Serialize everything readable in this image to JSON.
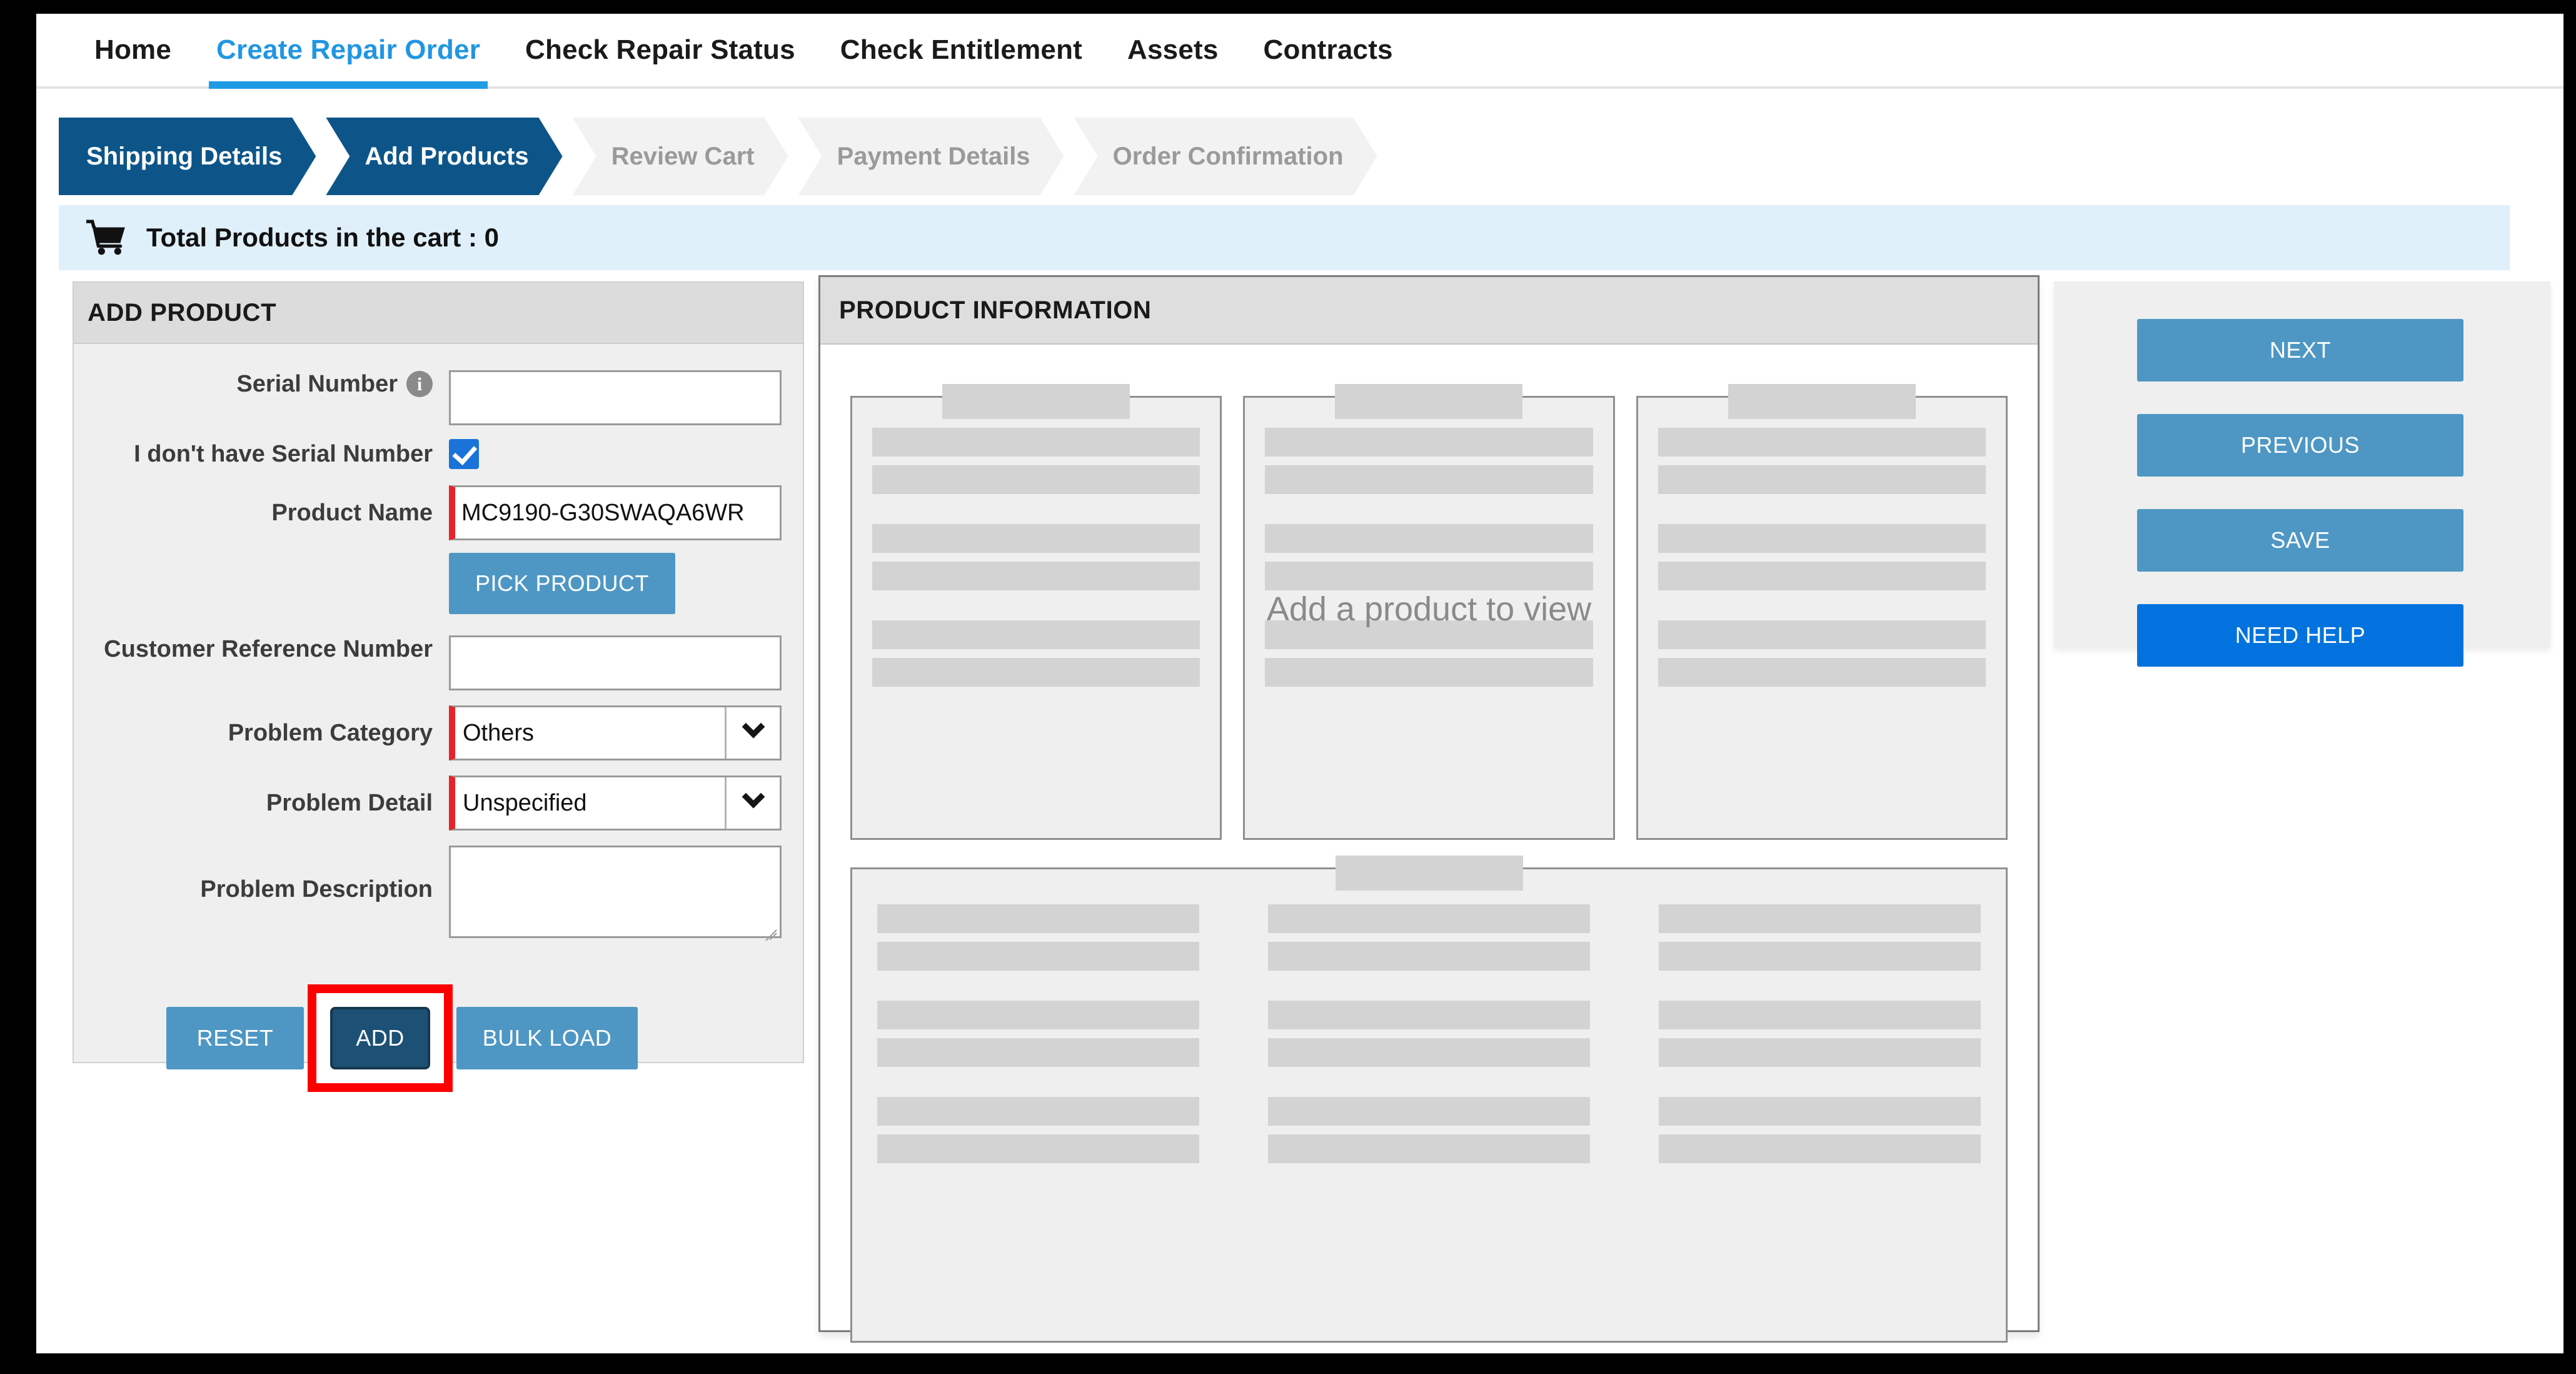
{
  "nav": {
    "tabs": [
      {
        "label": "Home",
        "active": false
      },
      {
        "label": "Create Repair Order",
        "active": true
      },
      {
        "label": "Check Repair Status",
        "active": false
      },
      {
        "label": "Check Entitlement",
        "active": false
      },
      {
        "label": "Assets",
        "active": false
      },
      {
        "label": "Contracts",
        "active": false
      }
    ]
  },
  "stepper": {
    "steps": [
      {
        "label": "Shipping Details",
        "state": "done"
      },
      {
        "label": "Add Products",
        "state": "current"
      },
      {
        "label": "Review Cart",
        "state": "todo"
      },
      {
        "label": "Payment Details",
        "state": "todo"
      },
      {
        "label": "Order Confirmation",
        "state": "todo"
      }
    ]
  },
  "cart_bar": {
    "icon": "shopping-cart-icon",
    "text": "Total Products in the cart : 0",
    "count": 0,
    "background": "#e0f0fb"
  },
  "add_product": {
    "title": "ADD PRODUCT",
    "fields": {
      "serial_number": {
        "label": "Serial Number",
        "value": "",
        "placeholder": "",
        "info_icon": "info-circle-icon"
      },
      "no_serial_number": {
        "label": "I don't have Serial Number",
        "checked": true
      },
      "product_name": {
        "label": "Product Name",
        "value": "MC9190-G30SWAQA6WR",
        "required": true
      },
      "customer_reference_number": {
        "label": "Customer Reference Number",
        "value": "",
        "placeholder": ""
      },
      "problem_category": {
        "label": "Problem Category",
        "value": "Others",
        "required": true,
        "icon": "chevron-down-icon"
      },
      "problem_detail": {
        "label": "Problem Detail",
        "value": "Unspecified",
        "required": true,
        "icon": "chevron-down-icon"
      },
      "problem_description": {
        "label": "Problem Description",
        "value": "",
        "placeholder": ""
      }
    },
    "buttons": {
      "pick_product": "PICK PRODUCT",
      "reset": "RESET",
      "add": "ADD",
      "bulk_load": "BULK LOAD"
    },
    "highlight": {
      "target": "ADD",
      "color": "#fc0000"
    }
  },
  "product_information": {
    "title": "PRODUCT INFORMATION",
    "empty_message": "Add a product to view",
    "skeleton": {
      "top_cards": 3,
      "top_card_bars": 6,
      "bottom_card_columns": 3,
      "bottom_card_bars_per_column": 6,
      "bar_color": "#d3d3d3",
      "card_color": "#efefef"
    }
  },
  "side_actions": {
    "buttons": [
      {
        "label": "NEXT",
        "style": "primary"
      },
      {
        "label": "PREVIOUS",
        "style": "primary"
      },
      {
        "label": "SAVE",
        "style": "primary"
      },
      {
        "label": "NEED HELP",
        "style": "help"
      }
    ]
  },
  "colors": {
    "accent_blue": "#1f9ce4",
    "step_active": "#0d5589",
    "button_blue": "#4e97c4",
    "help_blue": "#0273de",
    "required_red": "#e8232a",
    "highlight_red": "#fc0000",
    "checkbox_blue": "#1a73d8"
  }
}
